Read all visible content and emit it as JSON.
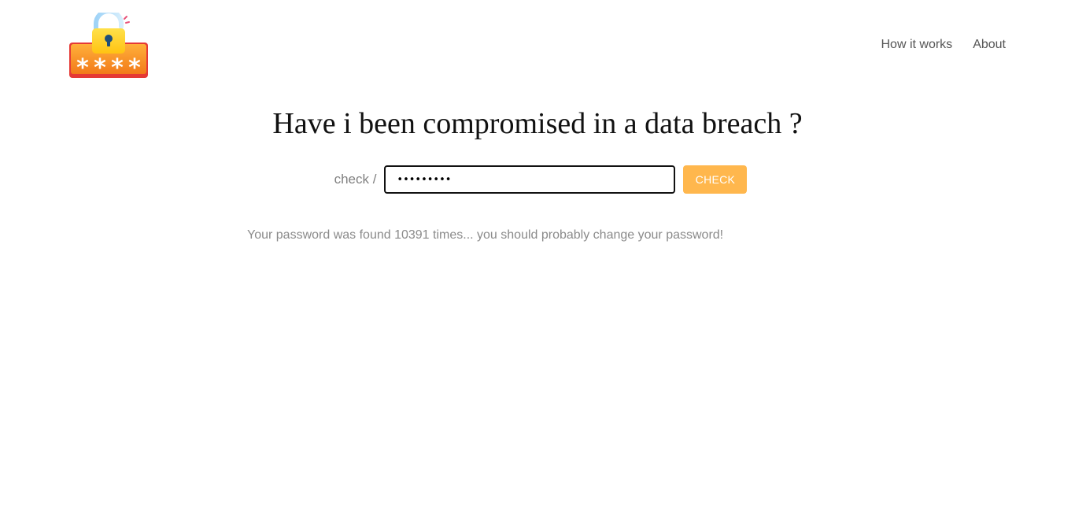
{
  "header": {
    "logo_icon": "padlock-password-icon",
    "nav": [
      {
        "label": "How it works"
      },
      {
        "label": "About"
      }
    ]
  },
  "main": {
    "title": "Have i been compromised in a data breach ?",
    "check_label": "check /",
    "password_value": "Secret123",
    "check_button_label": "CHECK",
    "result_text": "Your password was found 10391 times... you should probably change your password!"
  },
  "colors": {
    "button_bg": "#ffb74d",
    "text_muted": "#808080",
    "logo_orange": "#f7931e",
    "logo_yellow": "#ffd21f",
    "logo_red": "#e53935"
  }
}
